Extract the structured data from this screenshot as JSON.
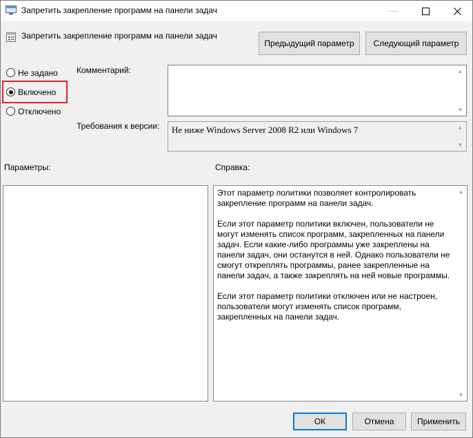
{
  "window": {
    "title": "Запретить закрепление программ на панели задач",
    "minimize": "—",
    "maximize": "☐",
    "close": "✕"
  },
  "header": {
    "policy_name": "Запретить закрепление программ на панели задач",
    "prev_button": "Предыдущий параметр",
    "next_button": "Следующий параметр"
  },
  "state": {
    "options": [
      "Не задано",
      "Включено",
      "Отключено"
    ],
    "selected": "Включено"
  },
  "comment": {
    "label": "Комментарий:",
    "value": ""
  },
  "supported": {
    "label": "Требования к версии:",
    "value": "Не ниже Windows Server 2008 R2 или Windows 7"
  },
  "options_panel": {
    "label": "Параметры:"
  },
  "help": {
    "label": "Справка:",
    "paragraphs": [
      "Этот параметр политики позволяет контролировать закрепление программ на панели задач.",
      "Если этот параметр политики включен, пользователи не могут изменять список программ, закрепленных на панели задач. Если какие-либо программы уже закреплены на панели задач, они останутся в ней. Однако пользователи не смогут откреплять программы, ранее закрепленные на панели задач, а также закреплять на ней новые программы.",
      "Если этот параметр политики отключен или не настроен, пользователи могут изменять список программ, закрепленных на панели задач."
    ]
  },
  "footer": {
    "ok": "ОК",
    "cancel": "Отмена",
    "apply": "Применить"
  },
  "icons": {
    "app": "policy-window-icon",
    "policy": "policy-settings-icon"
  },
  "colors": {
    "accent": "#0078d7",
    "highlight": "#e0242a",
    "background": "#f0f0f0"
  }
}
